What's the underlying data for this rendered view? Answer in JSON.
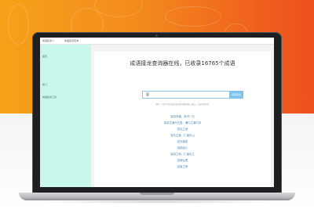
{
  "screen": {
    "topbar": {
      "left_link": "成语接龙>",
      "right_link": "成语接龙查询"
    },
    "sidebar": {
      "items": [
        "首页",
        "热门",
        "成语接龙工具"
      ]
    },
    "main": {
      "title": "成语接龙查询器在线，已收录16765个成语",
      "search_value": "容",
      "search_button": "搜索接龙",
      "hint": "提示：只需下方的成语接龙查询框里输入成语，点击查询即可",
      "results": [
        "容容多福，多可一日",
        "容容生满头白发，满口之满口亦",
        "容足之地",
        "容头过身，仁者乐山",
        "容光焕发",
        "容纳百川",
        "容容之地，仁者乐之",
        "容貌仪表",
        "容身之所"
      ]
    }
  }
}
